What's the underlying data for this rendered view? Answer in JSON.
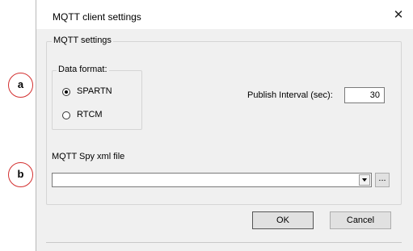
{
  "window": {
    "title": "MQTT client settings",
    "close_glyph": "✕"
  },
  "mqtt_settings": {
    "legend": "MQTT settings",
    "data_format": {
      "legend": "Data format:",
      "options": [
        {
          "label": "SPARTN",
          "selected": true
        },
        {
          "label": "RTCM",
          "selected": false
        }
      ]
    },
    "publish_interval": {
      "label": "Publish Interval (sec):",
      "value": "30"
    },
    "spy_file": {
      "label": "MQTT Spy xml file",
      "value": "",
      "browse_label": "..."
    }
  },
  "buttons": {
    "ok": "OK",
    "cancel": "Cancel"
  },
  "callouts": {
    "a": "a",
    "b": "b"
  },
  "colors": {
    "dialog_bg": "#f0f0f0",
    "callout_border": "#d32f2f"
  }
}
